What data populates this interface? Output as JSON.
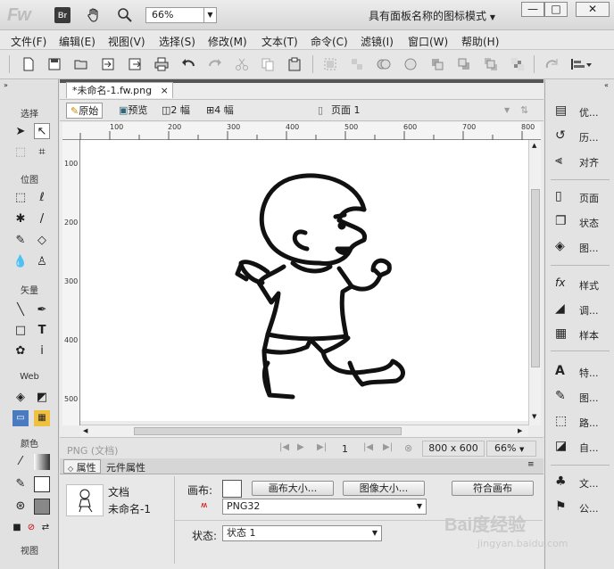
{
  "titlebar": {
    "app_logo": "Fw",
    "bridge_label": "Br",
    "zoom_value": "66%",
    "workspace": "具有面板名称的图标模式",
    "window_buttons": [
      "—",
      "□",
      "✕"
    ]
  },
  "menu": [
    "文件(F)",
    "编辑(E)",
    "视图(V)",
    "选择(S)",
    "修改(M)",
    "文本(T)",
    "命令(C)",
    "滤镜(I)",
    "窗口(W)",
    "帮助(H)"
  ],
  "document": {
    "tab_title": "*未命名-1.fw.png",
    "tab_close": "×",
    "view_modes": [
      "原始",
      "预览",
      "2 幅",
      "4 幅"
    ],
    "page_label": "页面 1",
    "ruler_h": [
      "100",
      "200",
      "300",
      "400",
      "500",
      "600",
      "700",
      "800"
    ],
    "ruler_v": [
      "100",
      "200",
      "300",
      "400",
      "500"
    ],
    "status": {
      "format": "PNG (文档)",
      "frame_number": "1",
      "canvas_size": "800 x 600",
      "zoom": "66%"
    }
  },
  "tools": {
    "sections": [
      "选择",
      "位图",
      "矢量",
      "Web",
      "颜色",
      "视图"
    ]
  },
  "properties": {
    "tabs": [
      "属性",
      "元件属性"
    ],
    "doc_label": "文档",
    "doc_name": "未命名-1",
    "canvas_label": "画布:",
    "canvas_size_btn": "画布大小...",
    "image_size_btn": "图像大小...",
    "fit_canvas_btn": "符合画布",
    "format_value": "PNG32",
    "state_label": "状态:",
    "state_value": "状态 1"
  },
  "right_panel": {
    "items": [
      "优...",
      "历...",
      "对齐",
      "页面",
      "状态",
      "图...",
      "样式",
      "调...",
      "样本",
      "特...",
      "图...",
      "路...",
      "自...",
      "文...",
      "公..."
    ]
  },
  "watermark": {
    "brand": "Bai度经验",
    "url": "jingyan.baidu.com"
  }
}
